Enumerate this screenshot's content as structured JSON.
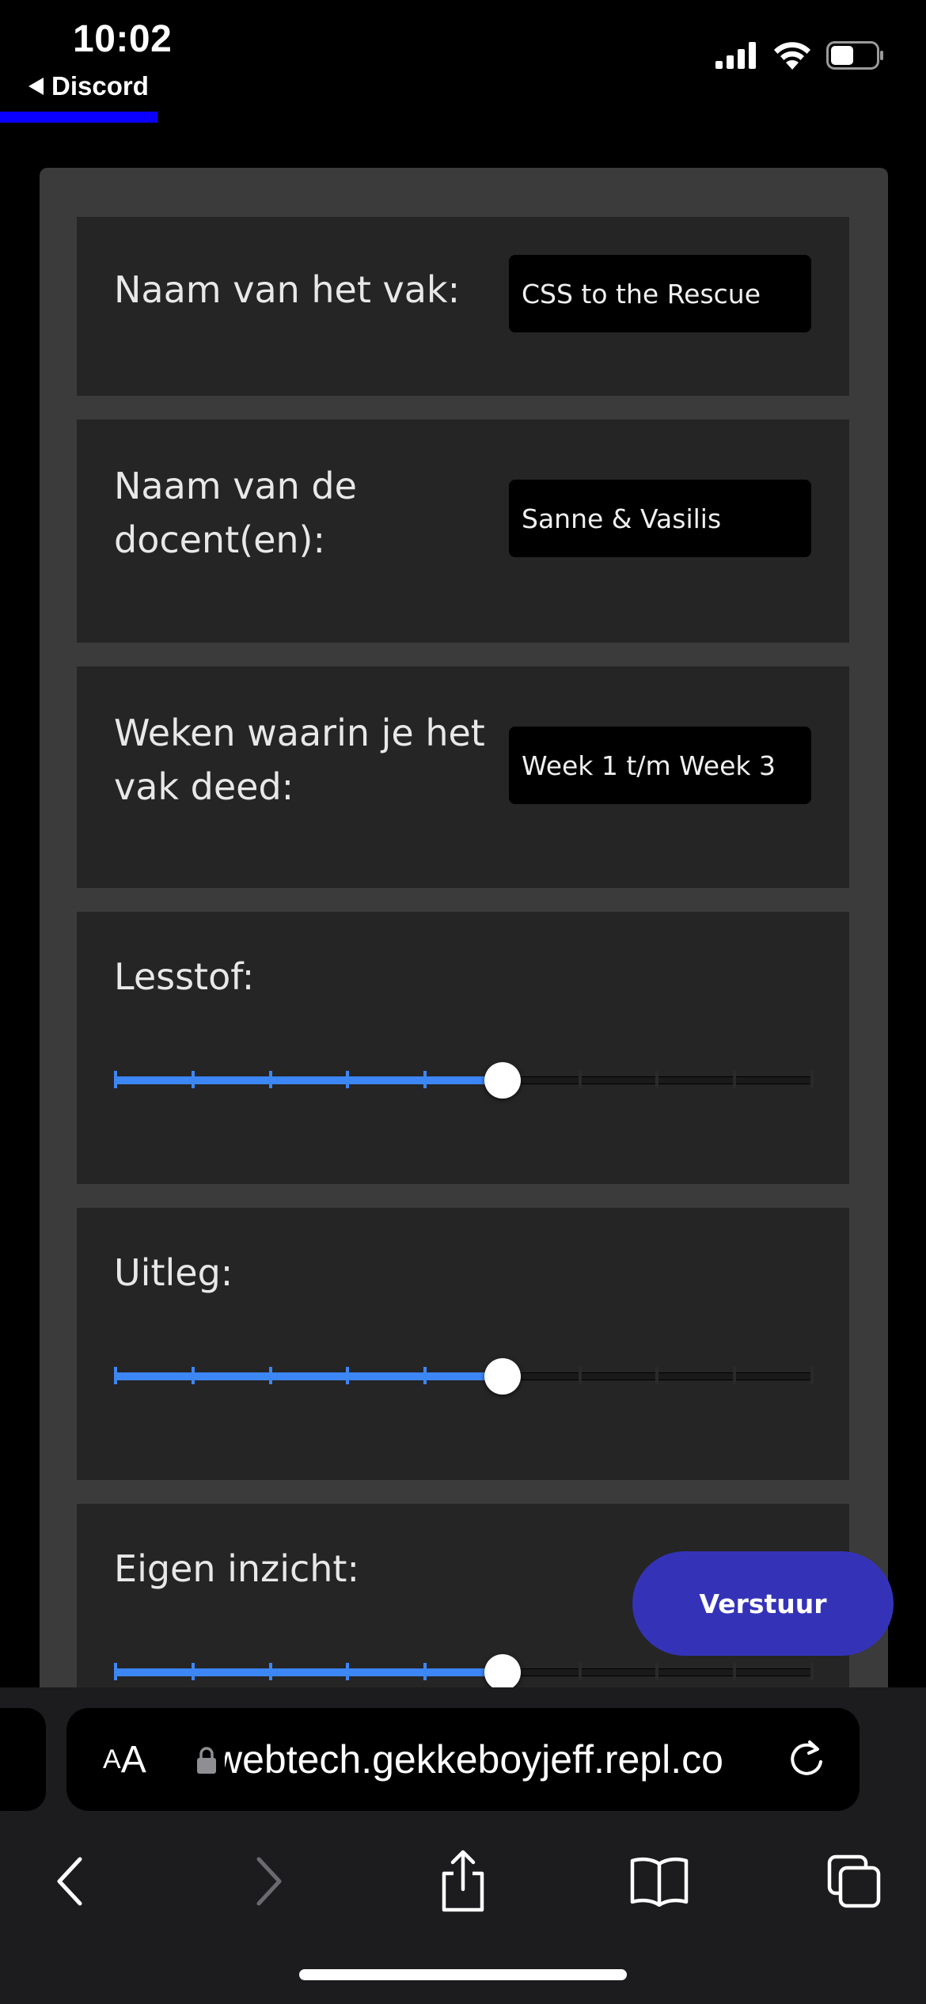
{
  "status_bar": {
    "time": "10:02",
    "back_app": "Discord",
    "page_load_progress": 0.17
  },
  "form": {
    "course_name": {
      "label": "Naam van het vak:",
      "value": "CSS to the Rescue"
    },
    "teachers": {
      "label": "Naam van de docent(en):",
      "value": "Sanne & Vasilis"
    },
    "weeks": {
      "label": "Weken waarin je het vak deed:",
      "value": "Week 1 t/m Week 3"
    },
    "sliders": [
      {
        "label": "Lesstof:",
        "value": 5,
        "max": 9
      },
      {
        "label": "Uitleg:",
        "value": 5,
        "max": 9
      },
      {
        "label": "Eigen inzicht:",
        "value": 5,
        "max": 9
      }
    ],
    "submit_label": "Verstuur"
  },
  "browser": {
    "text_size_small": "A",
    "text_size_big": "A",
    "url": "webtech.gekkeboyjeff.repl.co"
  },
  "colors": {
    "slider_accent": "#3d86f5",
    "submit_button": "#3433b8",
    "load_progress": "#0a00ff"
  }
}
